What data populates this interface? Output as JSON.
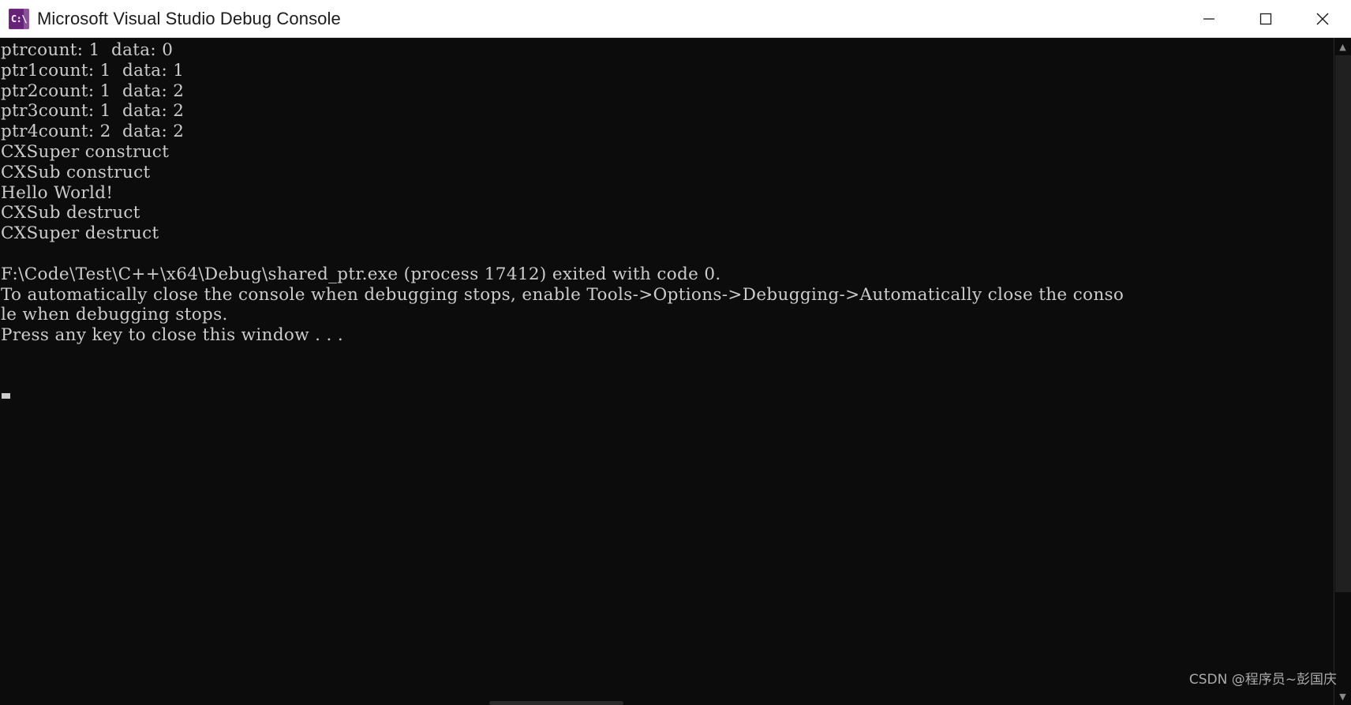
{
  "window": {
    "title": "Microsoft Visual Studio Debug Console",
    "icon_name": "console-app-icon",
    "icon_glyph": "C:\\",
    "icon_color": "#68217a",
    "titlebar_bg": "#ffffff",
    "titlebar_fg": "#1b1b1b"
  },
  "controls": {
    "minimize_label": "Minimize",
    "maximize_label": "Maximize",
    "close_label": "Close"
  },
  "console": {
    "bg_color": "#0c0c0c",
    "fg_color": "#cccccc",
    "lines": [
      "ptrcount: 1  data: 0",
      "ptr1count: 1  data: 1",
      "ptr2count: 1  data: 2",
      "ptr3count: 1  data: 2",
      "ptr4count: 2  data: 2",
      "CXSuper construct",
      "CXSub construct",
      "Hello World!",
      "CXSub destruct",
      "CXSuper destruct",
      "",
      "F:\\Code\\Test\\C++\\x64\\Debug\\shared_ptr.exe (process 17412) exited with code 0.",
      "To automatically close the console when debugging stops, enable Tools->Options->Debugging->Automatically close the conso",
      "le when debugging stops.",
      "Press any key to close this window . . ."
    ],
    "text": "ptrcount: 1  data: 0\nptr1count: 1  data: 1\nptr2count: 1  data: 2\nptr3count: 1  data: 2\nptr4count: 2  data: 2\nCXSuper construct\nCXSub construct\nHello World!\nCXSub destruct\nCXSuper destruct\n\nF:\\Code\\Test\\C++\\x64\\Debug\\shared_ptr.exe (process 17412) exited with code 0.\nTo automatically close the console when debugging stops, enable Tools->Options->Debugging->Automatically close the conso\nle when debugging stops.\nPress any key to close this window . . ."
  },
  "scrollbar": {
    "up_arrow": "▲",
    "down_arrow": "▼"
  },
  "watermark": {
    "text": "CSDN @程序员~彭国庆"
  }
}
